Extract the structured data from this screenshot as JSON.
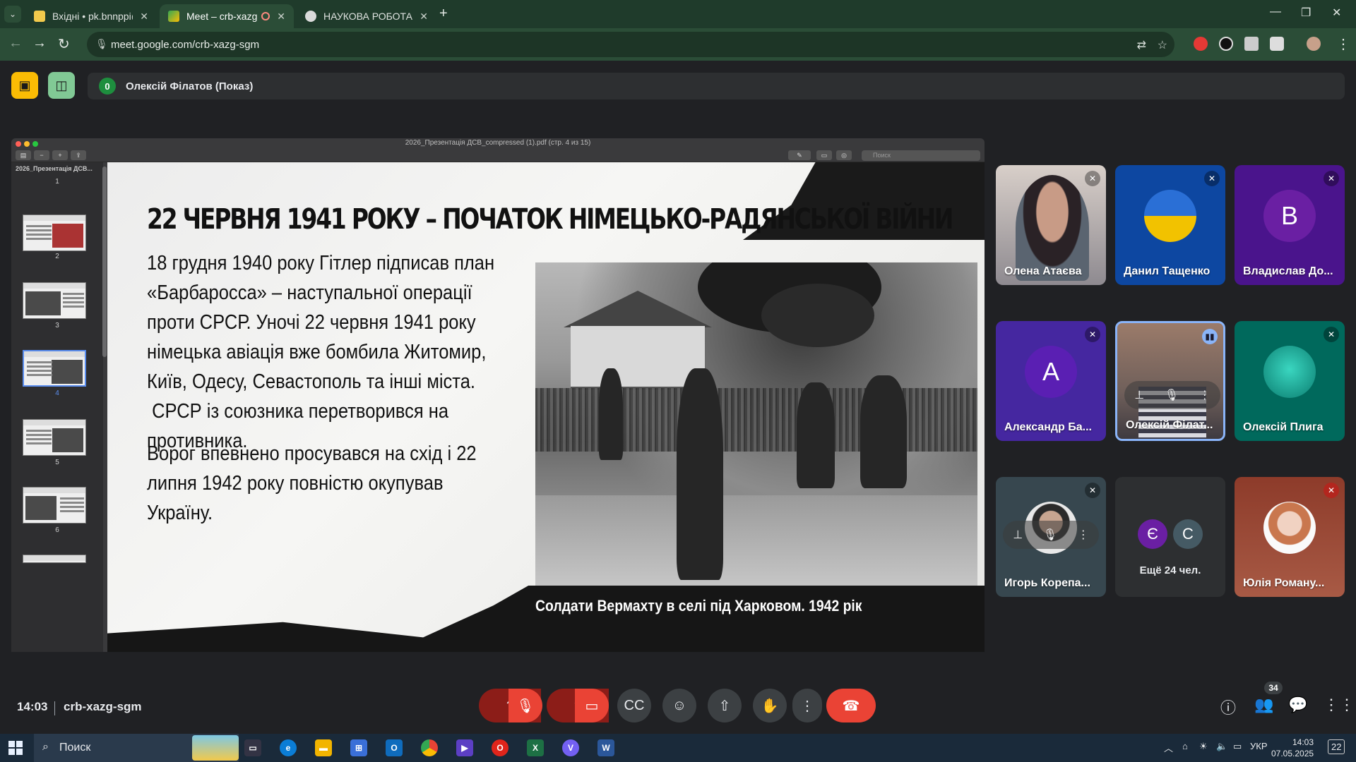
{
  "browser": {
    "tabs": [
      {
        "label": "Вхідні • pk.bnnppi@ukr.net",
        "active": false
      },
      {
        "label": "Meet – crb-xazg-sgm",
        "active": true
      },
      {
        "label": "НАУКОВА РОБОТА ЗІ СТУДЕНТ",
        "active": false
      }
    ],
    "new_tab": "+",
    "url": "meet.google.com/crb-xazg-sgm",
    "window_controls": [
      "—",
      "❐",
      "✕"
    ]
  },
  "presentation_bar": {
    "count": "0",
    "presenter": "Олексій Філатов (Показ)"
  },
  "pdf": {
    "title": "2026_Презентація ДСВ_compressed (1).pdf (стр. 4 из 15)",
    "sidebar_title": "2026_Презентація ДСВ...",
    "search_placeholder": "Поиск",
    "thumbs": [
      "1",
      "2",
      "3",
      "4",
      "5",
      "6"
    ],
    "selected_page": "4"
  },
  "slide": {
    "title": "22 ЧЕРВНЯ 1941 РОКУ – ПОЧАТОК НІМЕЦЬКО-РАДЯНСЬКОЇ ВІЙНИ",
    "para1": [
      "18 грудня 1940 року Гітлер підписав план",
      "«Барбаросса» – наступальної операції",
      "проти СРСР. Уночі 22 червня 1941 року",
      "німецька авіація вже бомбила Житомир,",
      "Київ, Одесу, Севастополь та інші міста.",
      " СРСР із союзника перетворився на",
      "противника."
    ],
    "para2": [
      "Ворог впевнено просувався на схід і 22",
      "липня 1942 року повністю окупував",
      "Україну."
    ],
    "caption": "Солдати Вермахту в селі під Харковом. 1942 рік"
  },
  "participants": [
    {
      "name": "Олена Атаєва",
      "kind": "video"
    },
    {
      "name": "Данил Тащенко",
      "kind": "avatar-photo"
    },
    {
      "name": "Владислав До...",
      "kind": "letter",
      "letter": "В",
      "bg": "#6a1fa3"
    },
    {
      "name": "Александр Ба...",
      "kind": "letter",
      "letter": "А",
      "bg": "#5a1fb3"
    },
    {
      "name": "Олексій Філат...",
      "kind": "video-active"
    },
    {
      "name": "Олексій Плига",
      "kind": "avatar-photo"
    },
    {
      "name": "Игорь Корепа...",
      "kind": "avatar-photo"
    },
    {
      "name": "Ещё 24 чел.",
      "kind": "more",
      "letters": [
        "Є",
        "С"
      ]
    },
    {
      "name": "Юлія Роману...",
      "kind": "avatar-photo"
    }
  ],
  "meeting": {
    "time": "14:03",
    "code": "crb-xazg-sgm",
    "people_count": "34"
  },
  "taskbar": {
    "search_placeholder": "Поиск",
    "lang": "УКР",
    "time": "14:03",
    "date": "07.05.2025",
    "notifications": "22"
  }
}
